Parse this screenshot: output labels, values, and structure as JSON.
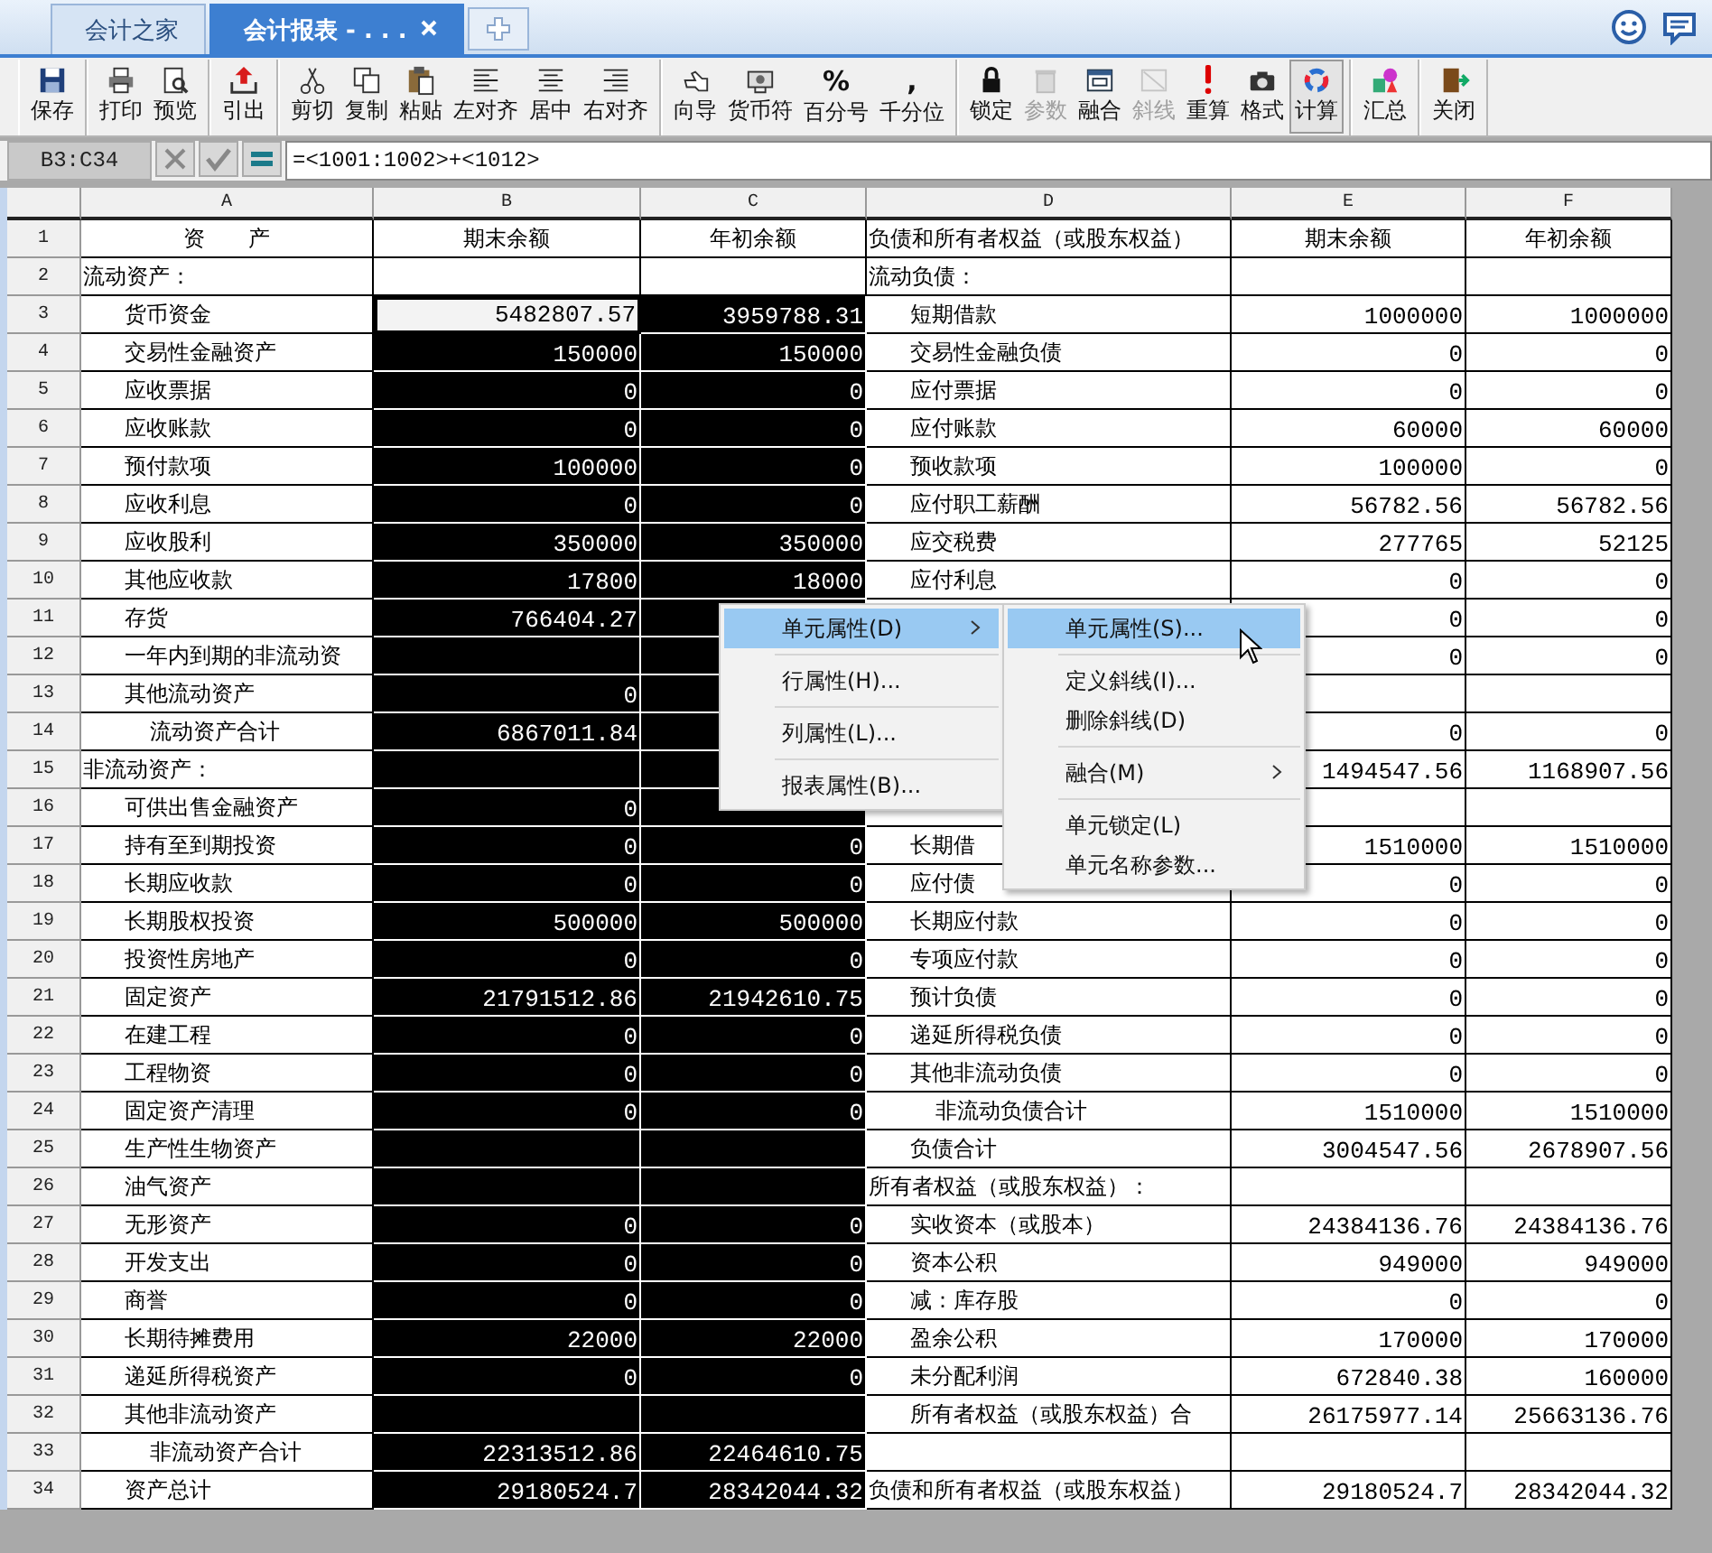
{
  "tabs": [
    {
      "label": "会计之家",
      "selected": false,
      "closable": false
    },
    {
      "label": "会计报表 - . . .",
      "selected": true,
      "closable": true
    }
  ],
  "toolbar": [
    {
      "tools": [
        {
          "label": "保存",
          "disabled": false,
          "pressed": false
        }
      ]
    },
    {
      "tools": [
        {
          "label": "打印",
          "disabled": false,
          "pressed": false
        },
        {
          "label": "预览",
          "disabled": false,
          "pressed": false
        }
      ]
    },
    {
      "tools": [
        {
          "label": "引出",
          "disabled": false,
          "pressed": false
        }
      ]
    },
    {
      "tools": [
        {
          "label": "剪切",
          "disabled": false,
          "pressed": false
        },
        {
          "label": "复制",
          "disabled": false,
          "pressed": false
        },
        {
          "label": "粘贴",
          "disabled": false,
          "pressed": false
        },
        {
          "label": "左对齐",
          "disabled": false,
          "pressed": false
        },
        {
          "label": "居中",
          "disabled": false,
          "pressed": false
        },
        {
          "label": "右对齐",
          "disabled": false,
          "pressed": false
        }
      ]
    },
    {
      "tools": [
        {
          "label": "向导",
          "disabled": false,
          "pressed": false
        },
        {
          "label": "货币符",
          "disabled": false,
          "pressed": false
        },
        {
          "label": "百分号",
          "glyph": "%",
          "disabled": false,
          "pressed": false
        },
        {
          "label": "千分位",
          "glyph": ",",
          "disabled": false,
          "pressed": false
        }
      ]
    },
    {
      "tools": [
        {
          "label": "锁定",
          "disabled": false,
          "pressed": false
        },
        {
          "label": "参数",
          "disabled": true,
          "pressed": false
        },
        {
          "label": "融合",
          "disabled": false,
          "pressed": false
        },
        {
          "label": "斜线",
          "disabled": true,
          "pressed": false
        },
        {
          "label": "重算",
          "disabled": false,
          "pressed": false
        },
        {
          "label": "格式",
          "disabled": false,
          "pressed": false
        },
        {
          "label": "计算",
          "disabled": false,
          "pressed": true
        }
      ]
    },
    {
      "tools": [
        {
          "label": "汇总",
          "disabled": false,
          "pressed": false
        }
      ]
    },
    {
      "tools": [
        {
          "label": "关闭",
          "disabled": false,
          "pressed": false
        }
      ]
    }
  ],
  "formula_bar": {
    "cell_range": "B3:C34",
    "formula": "=<1001:1002>+<1012>"
  },
  "sheet": {
    "columns": [
      "A",
      "B",
      "C",
      "D",
      "E",
      "F"
    ],
    "rows": [
      {
        "n": "1",
        "selected": false,
        "active": false,
        "a": {
          "text": "资　　产",
          "kind": "header"
        },
        "b": "期末余额",
        "c": "年初余额",
        "d": {
          "text": "负债和所有者权益（或股东权益）",
          "kind": "section"
        },
        "e": "期末余额",
        "f": "年初余额"
      },
      {
        "n": "2",
        "selected": false,
        "active": false,
        "a": {
          "text": "流动资产：",
          "kind": "section"
        },
        "d": {
          "text": "流动负债：",
          "kind": "section"
        }
      },
      {
        "n": "3",
        "selected": true,
        "active": true,
        "a": {
          "text": "货币资金",
          "kind": "item"
        },
        "b": "5482807.57",
        "c": "3959788.31",
        "d": {
          "text": "短期借款",
          "kind": "item"
        },
        "e": "1000000",
        "f": "1000000"
      },
      {
        "n": "4",
        "selected": true,
        "active": false,
        "a": {
          "text": "交易性金融资产",
          "kind": "item"
        },
        "b": "150000",
        "c": "150000",
        "d": {
          "text": "交易性金融负债",
          "kind": "item"
        },
        "e": "0",
        "f": "0"
      },
      {
        "n": "5",
        "selected": true,
        "active": false,
        "a": {
          "text": "应收票据",
          "kind": "item"
        },
        "b": "0",
        "c": "0",
        "d": {
          "text": "应付票据",
          "kind": "item"
        },
        "e": "0",
        "f": "0"
      },
      {
        "n": "6",
        "selected": true,
        "active": false,
        "a": {
          "text": "应收账款",
          "kind": "item"
        },
        "b": "0",
        "c": "0",
        "d": {
          "text": "应付账款",
          "kind": "item"
        },
        "e": "60000",
        "f": "60000"
      },
      {
        "n": "7",
        "selected": true,
        "active": false,
        "a": {
          "text": "预付款项",
          "kind": "item"
        },
        "b": "100000",
        "c": "0",
        "d": {
          "text": "预收款项",
          "kind": "item"
        },
        "e": "100000",
        "f": "0"
      },
      {
        "n": "8",
        "selected": true,
        "active": false,
        "a": {
          "text": "应收利息",
          "kind": "item"
        },
        "b": "0",
        "c": "0",
        "d": {
          "text": "应付职工薪酬",
          "kind": "item"
        },
        "e": "56782.56",
        "f": "56782.56"
      },
      {
        "n": "9",
        "selected": true,
        "active": false,
        "a": {
          "text": "应收股利",
          "kind": "item"
        },
        "b": "350000",
        "c": "350000",
        "d": {
          "text": "应交税费",
          "kind": "item"
        },
        "e": "277765",
        "f": "52125"
      },
      {
        "n": "10",
        "selected": true,
        "active": false,
        "a": {
          "text": "其他应收款",
          "kind": "item"
        },
        "b": "17800",
        "c": "18000",
        "d": {
          "text": "应付利息",
          "kind": "item"
        },
        "e": "0",
        "f": "0"
      },
      {
        "n": "11",
        "selected": true,
        "active": false,
        "a": {
          "text": "存货",
          "kind": "item"
        },
        "b": "766404.27",
        "e": "0",
        "f": "0"
      },
      {
        "n": "12",
        "selected": true,
        "active": false,
        "a": {
          "text": "一年内到期的非流动资",
          "kind": "item"
        },
        "e": "0",
        "f": "0"
      },
      {
        "n": "13",
        "selected": true,
        "active": false,
        "a": {
          "text": "其他流动资产",
          "kind": "item"
        },
        "b": "0"
      },
      {
        "n": "14",
        "selected": true,
        "active": false,
        "a": {
          "text": "流动资产合计",
          "kind": "subtotal"
        },
        "b": "6867011.84",
        "e": "0",
        "f": "0"
      },
      {
        "n": "15",
        "selected": true,
        "active": false,
        "a": {
          "text": "非流动资产：",
          "kind": "section"
        },
        "e": "1494547.56",
        "f": "1168907.56"
      },
      {
        "n": "16",
        "selected": true,
        "active": false,
        "a": {
          "text": "可供出售金融资产",
          "kind": "item"
        },
        "b": "0"
      },
      {
        "n": "17",
        "selected": true,
        "active": false,
        "a": {
          "text": "持有至到期投资",
          "kind": "item"
        },
        "b": "0",
        "c": "0",
        "d": {
          "text": "长期借",
          "kind": "item"
        },
        "e": "1510000",
        "f": "1510000"
      },
      {
        "n": "18",
        "selected": true,
        "active": false,
        "a": {
          "text": "长期应收款",
          "kind": "item"
        },
        "b": "0",
        "c": "0",
        "d": {
          "text": "应付债",
          "kind": "item"
        },
        "e": "0",
        "f": "0"
      },
      {
        "n": "19",
        "selected": true,
        "active": false,
        "a": {
          "text": "长期股权投资",
          "kind": "item"
        },
        "b": "500000",
        "c": "500000",
        "d": {
          "text": "长期应付款",
          "kind": "item"
        },
        "e": "0",
        "f": "0"
      },
      {
        "n": "20",
        "selected": true,
        "active": false,
        "a": {
          "text": "投资性房地产",
          "kind": "item"
        },
        "b": "0",
        "c": "0",
        "d": {
          "text": "专项应付款",
          "kind": "item"
        },
        "e": "0",
        "f": "0"
      },
      {
        "n": "21",
        "selected": true,
        "active": false,
        "a": {
          "text": "固定资产",
          "kind": "item"
        },
        "b": "21791512.86",
        "c": "21942610.75",
        "d": {
          "text": "预计负债",
          "kind": "item"
        },
        "e": "0",
        "f": "0"
      },
      {
        "n": "22",
        "selected": true,
        "active": false,
        "a": {
          "text": "在建工程",
          "kind": "item"
        },
        "b": "0",
        "c": "0",
        "d": {
          "text": "递延所得税负债",
          "kind": "item"
        },
        "e": "0",
        "f": "0"
      },
      {
        "n": "23",
        "selected": true,
        "active": false,
        "a": {
          "text": "工程物资",
          "kind": "item"
        },
        "b": "0",
        "c": "0",
        "d": {
          "text": "其他非流动负债",
          "kind": "item"
        },
        "e": "0",
        "f": "0"
      },
      {
        "n": "24",
        "selected": true,
        "active": false,
        "a": {
          "text": "固定资产清理",
          "kind": "item"
        },
        "b": "0",
        "c": "0",
        "d": {
          "text": "非流动负债合计",
          "kind": "subtotal"
        },
        "e": "1510000",
        "f": "1510000"
      },
      {
        "n": "25",
        "selected": true,
        "active": false,
        "a": {
          "text": "生产性生物资产",
          "kind": "item"
        },
        "d": {
          "text": "负债合计",
          "kind": "item"
        },
        "e": "3004547.56",
        "f": "2678907.56"
      },
      {
        "n": "26",
        "selected": true,
        "active": false,
        "a": {
          "text": "油气资产",
          "kind": "item"
        },
        "d": {
          "text": "所有者权益（或股东权益）：",
          "kind": "section"
        }
      },
      {
        "n": "27",
        "selected": true,
        "active": false,
        "a": {
          "text": "无形资产",
          "kind": "item"
        },
        "b": "0",
        "c": "0",
        "d": {
          "text": "实收资本（或股本）",
          "kind": "item"
        },
        "e": "24384136.76",
        "f": "24384136.76"
      },
      {
        "n": "28",
        "selected": true,
        "active": false,
        "a": {
          "text": "开发支出",
          "kind": "item"
        },
        "b": "0",
        "c": "0",
        "d": {
          "text": "资本公积",
          "kind": "item"
        },
        "e": "949000",
        "f": "949000"
      },
      {
        "n": "29",
        "selected": true,
        "active": false,
        "a": {
          "text": "商誉",
          "kind": "item"
        },
        "b": "0",
        "c": "0",
        "d": {
          "text": "减：库存股",
          "kind": "item"
        },
        "e": "0",
        "f": "0"
      },
      {
        "n": "30",
        "selected": true,
        "active": false,
        "a": {
          "text": "长期待摊费用",
          "kind": "item"
        },
        "b": "22000",
        "c": "22000",
        "d": {
          "text": "盈余公积",
          "kind": "item"
        },
        "e": "170000",
        "f": "170000"
      },
      {
        "n": "31",
        "selected": true,
        "active": false,
        "a": {
          "text": "递延所得税资产",
          "kind": "item"
        },
        "b": "0",
        "c": "0",
        "d": {
          "text": "未分配利润",
          "kind": "item"
        },
        "e": "672840.38",
        "f": "160000"
      },
      {
        "n": "32",
        "selected": true,
        "active": false,
        "a": {
          "text": "其他非流动资产",
          "kind": "item"
        },
        "d": {
          "text": "所有者权益（或股东权益）合",
          "kind": "item"
        },
        "e": "26175977.14",
        "f": "25663136.76"
      },
      {
        "n": "33",
        "selected": true,
        "active": false,
        "a": {
          "text": "非流动资产合计",
          "kind": "subtotal"
        },
        "b": "22313512.86",
        "c": "22464610.75"
      },
      {
        "n": "34",
        "selected": true,
        "active": false,
        "a": {
          "text": "资产总计",
          "kind": "item"
        },
        "b": "29180524.7",
        "c": "28342044.32",
        "d": {
          "text": "负债和所有者权益（或股东权益）",
          "kind": "section"
        },
        "e": "29180524.7",
        "f": "28342044.32"
      }
    ]
  },
  "context_menu": {
    "items": [
      {
        "kind": "item",
        "label": "单元属性(D)",
        "selected": true,
        "submenu": true
      },
      {
        "kind": "separator"
      },
      {
        "kind": "item",
        "label": "行属性(H)...",
        "selected": false,
        "submenu": false
      },
      {
        "kind": "separator"
      },
      {
        "kind": "item",
        "label": "列属性(L)...",
        "selected": false,
        "submenu": false
      },
      {
        "kind": "separator"
      },
      {
        "kind": "item",
        "label": "报表属性(B)...",
        "selected": false,
        "submenu": false
      }
    ]
  },
  "submenu": {
    "items": [
      {
        "kind": "item",
        "label": "单元属性(S)...",
        "selected": true,
        "submenu": false
      },
      {
        "kind": "separator"
      },
      {
        "kind": "item",
        "label": "定义斜线(I)...",
        "selected": false,
        "submenu": false
      },
      {
        "kind": "item",
        "label": "删除斜线(D)",
        "selected": false,
        "submenu": false
      },
      {
        "kind": "separator"
      },
      {
        "kind": "item",
        "label": "融合(M)",
        "selected": false,
        "submenu": true
      },
      {
        "kind": "separator"
      },
      {
        "kind": "item",
        "label": "单元锁定(L)",
        "selected": false,
        "submenu": false
      },
      {
        "kind": "item",
        "label": "单元名称参数...",
        "selected": false,
        "submenu": false
      }
    ]
  }
}
